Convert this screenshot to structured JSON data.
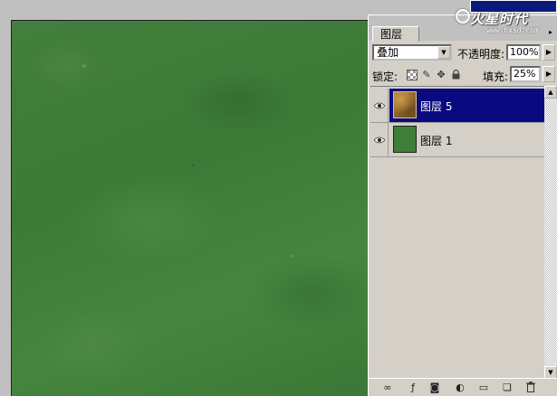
{
  "watermark": {
    "logo": "火星时代",
    "url": "www.hxsd.com"
  },
  "layers_panel": {
    "tab_label": "图层",
    "menu_arrow": "▸",
    "blend_mode": "叠加",
    "opacity_label": "不透明度:",
    "opacity_value": "100%",
    "lock_label": "锁定:",
    "fill_label": "填充:",
    "fill_value": "25%",
    "layers": [
      {
        "name": "图层 5",
        "selected": true,
        "visible": true
      },
      {
        "name": "图层 1",
        "selected": false,
        "visible": true
      }
    ]
  },
  "icons": {
    "dropdown": "▼",
    "flyout": "▶",
    "scroll_up": "▲",
    "scroll_down": "▼",
    "lock_pixels": "✎",
    "lock_position": "✥",
    "lock_all": "🔒",
    "link_layers": "∞",
    "layer_style": "ƒ",
    "add_mask": "◙",
    "new_adjustment": "◐",
    "new_group": "▭",
    "new_layer": "❏",
    "delete_layer": "🗑"
  },
  "colors": {
    "canvas_green": "#3f7e3a",
    "selection_blue": "#0a0a80",
    "panel_gray": "#d4d0c8"
  }
}
